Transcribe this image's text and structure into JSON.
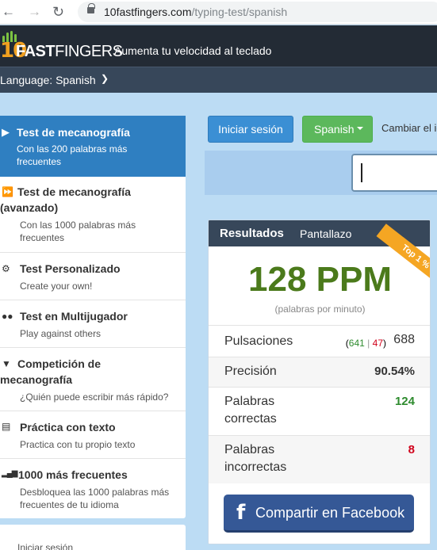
{
  "browser": {
    "url_domain": "10fastfingers.com",
    "url_path": "/typing-test/spanish"
  },
  "header": {
    "logo_ten": "10",
    "logo_fast": "FAST",
    "logo_fingers": "FINGERS",
    "tagline": "Aumenta tu velocidad al teclado",
    "language_label": "Language: Spanish"
  },
  "sidebar": {
    "items": [
      {
        "title": "Test de mecanografía",
        "desc": "Con las 200 palabras más frecuentes",
        "icon": "play-icon"
      },
      {
        "title": "Test de mecanografía (avanzado)",
        "desc": "Con las 1000 palabras más frecuentes",
        "icon": "fast-forward-icon"
      },
      {
        "title": "Test Personalizado",
        "desc": "Create your own!",
        "icon": "gears-icon"
      },
      {
        "title": "Test en Multijugador",
        "desc": "Play against others",
        "icon": "users-icon"
      },
      {
        "title": "Competición de mecanografía",
        "desc": "¿Quién puede escribir más rápido?",
        "icon": "trophy-icon"
      },
      {
        "title": "Práctica con texto",
        "desc": "Practica con tu propio texto",
        "icon": "document-icon"
      },
      {
        "title": "1000 más frecuentes",
        "desc": "Desbloquea las 1000 palabras más frecuentes de tu idioma",
        "icon": "signal-bars-icon"
      }
    ],
    "bottom_text": "Iniciar sesión"
  },
  "toolbar": {
    "login_label": "Iniciar sesión",
    "language_button": "Spanish",
    "change_label": "Cambiar el id"
  },
  "results": {
    "title": "Resultados",
    "screenshot_label": "Pantallazo",
    "ribbon": "Top 1 %",
    "wpm": "128 PPM",
    "wpm_sub": "(palabras por minuto)",
    "keystrokes_label": "Pulsaciones",
    "keystrokes_correct": "641",
    "keystrokes_sep": "|",
    "keystrokes_wrong": "47",
    "keystrokes_total": "688",
    "accuracy_label": "Precisión",
    "accuracy_value": "90.54%",
    "correct_words_label": "Palabras correctas",
    "correct_words_value": "124",
    "wrong_words_label": "Palabras incorrectas",
    "wrong_words_value": "8",
    "facebook_icon": "f",
    "facebook_label": "Compartir en Facebook"
  },
  "colors": {
    "header_bg": "#232b35",
    "accent_blue": "#2f7fc1",
    "wpm_green": "#4b7a1b",
    "ribbon_orange": "#f5a623",
    "facebook_blue": "#355896"
  }
}
